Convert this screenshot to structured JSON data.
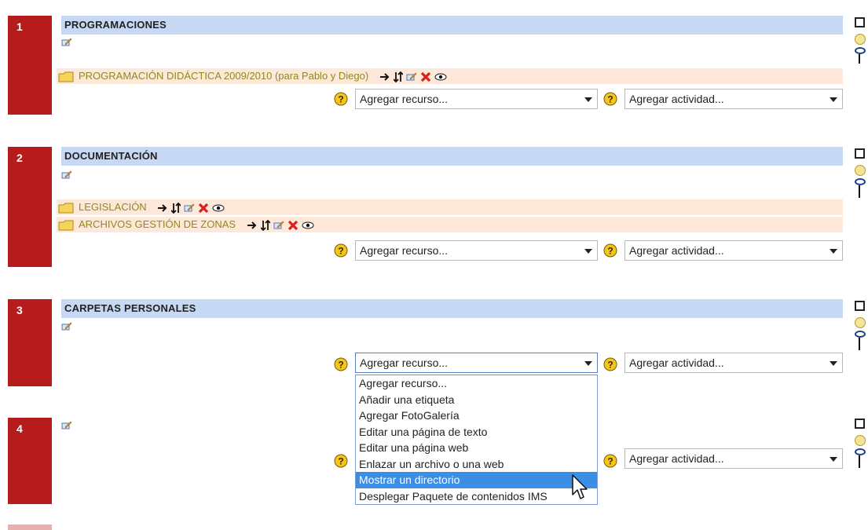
{
  "topics": [
    {
      "number": "1",
      "title": "PROGRAMACIONES",
      "resources": [
        {
          "label": "PROGRAMACIÓN DIDÁCTICA 2009/2010 (para Pablo y Diego)"
        }
      ]
    },
    {
      "number": "2",
      "title": "DOCUMENTACIÓN",
      "resources": [
        {
          "label": "LEGISLACIÓN"
        },
        {
          "label": "ARCHIVOS GESTIÓN DE ZONAS"
        }
      ]
    },
    {
      "number": "3",
      "title": "CARPETAS PERSONALES",
      "resources": []
    },
    {
      "number": "4",
      "title": "",
      "resources": []
    }
  ],
  "selects": {
    "resource_placeholder": "Agregar recurso...",
    "activity_placeholder": "Agregar actividad..."
  },
  "dropdown": {
    "options": [
      "Agregar recurso...",
      "Añadir una etiqueta",
      "Agregar FotoGalería",
      "Editar una página de texto",
      "Editar una página web",
      "Enlazar un archivo o una web",
      "Mostrar un directorio",
      "Desplegar Paquete de contenidos IMS"
    ],
    "highlighted_index": 6
  },
  "colors": {
    "topic_red": "#b71c1c",
    "header_blue": "#c7d8f5",
    "resource_bg": "#fde8da",
    "link_olive": "#8c8c1d",
    "highlight": "#3a8ee6"
  },
  "icons": [
    "edit-icon",
    "folder-icon",
    "move-right-icon",
    "move-updown-icon",
    "delete-icon",
    "eye-icon",
    "help-icon",
    "lightbulb-icon"
  ]
}
